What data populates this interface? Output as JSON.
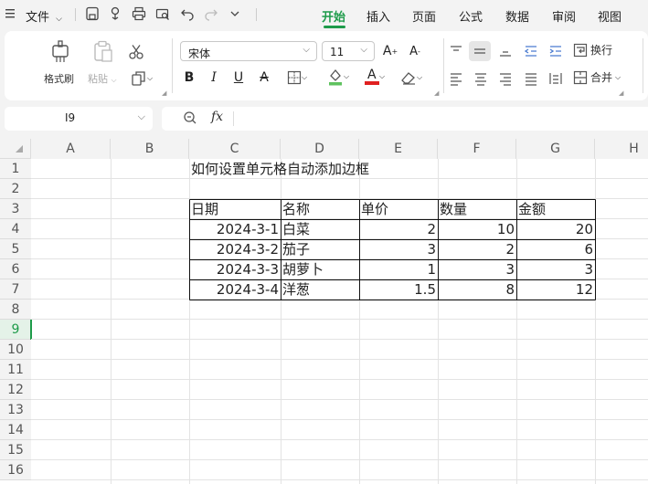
{
  "menubar": {
    "file_label": "文件",
    "tabs": [
      {
        "label": "开始",
        "active": true
      },
      {
        "label": "插入"
      },
      {
        "label": "页面"
      },
      {
        "label": "公式"
      },
      {
        "label": "数据"
      },
      {
        "label": "审阅"
      },
      {
        "label": "视图"
      }
    ]
  },
  "ribbon": {
    "format_painter_label": "格式刷",
    "paste_label": "粘贴",
    "font_name": "宋体",
    "font_size": "11",
    "wrap_label": "换行",
    "merge_label": "合并",
    "bold": "B",
    "italic": "I",
    "underline": "U",
    "strike": "A",
    "font_color_letter": "A",
    "grow_font": "A",
    "shrink_font": "A"
  },
  "formula_bar": {
    "name_box": "I9",
    "fx": "fx",
    "content": ""
  },
  "grid": {
    "columns": [
      "A",
      "B",
      "C",
      "D",
      "E",
      "F",
      "G",
      "H"
    ],
    "rows": [
      "1",
      "2",
      "3",
      "4",
      "5",
      "6",
      "7",
      "8",
      "9",
      "10",
      "11",
      "12",
      "13",
      "14",
      "15",
      "16"
    ],
    "active_row": "9",
    "title_cell": "如何设置单元格自动添加边框",
    "table": {
      "headers": [
        "日期",
        "名称",
        "单价",
        "数量",
        "金额"
      ],
      "rows": [
        [
          "2024-3-1",
          "白菜",
          "2",
          "10",
          "20"
        ],
        [
          "2024-3-2",
          "茄子",
          "3",
          "2",
          "6"
        ],
        [
          "2024-3-3",
          "胡萝卜",
          "1",
          "3",
          "3"
        ],
        [
          "2024-3-4",
          "洋葱",
          "1.5",
          "8",
          "12"
        ]
      ]
    }
  },
  "colors": {
    "accent": "#1e9b4a",
    "fill_color": "#f5e400",
    "font_color": "#e02020"
  }
}
